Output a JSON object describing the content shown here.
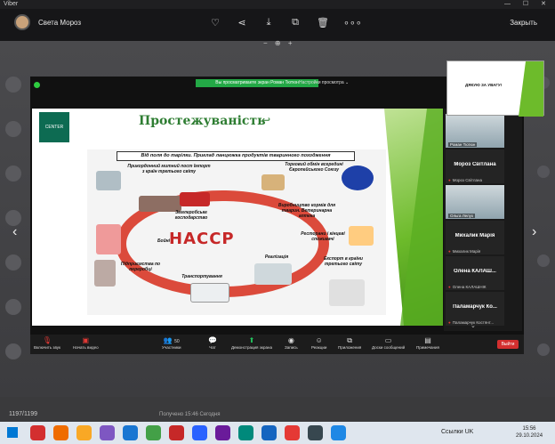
{
  "app": {
    "name": "Viber",
    "window_controls": "— ☐ ✕"
  },
  "viewer": {
    "sender": "Света Мороз",
    "close_label": "Закрыть",
    "icons": [
      "heart-icon",
      "share-icon",
      "download-icon",
      "crop-icon",
      "trash-icon",
      "more-icon"
    ],
    "zoom_controls": "− ⊕ +"
  },
  "zoom": {
    "banner": "Вы просматриваете экран Роман Тютюн",
    "view_options": "Настройки просмотра ⌄",
    "slide": {
      "logo_text": "CENTER",
      "title": "Простежуваність",
      "caption": "Від поля до тарілки. Приклад ланцюжка продуктів тваринного походження",
      "center_label": "HACCP",
      "labels": {
        "border": "Прикордонний митний пост Імпорт з країн третього світу",
        "trade": "Торговий обмін всередині Європейського Союзу",
        "farm": "Землеробське господарство",
        "feed": "Виробництво кормів для тварин. Ветеринарна аптека",
        "slaughter": "Бойні",
        "restaurants": "Ресторани і кінцеві споживачі",
        "processing": "Підприємства по переробці",
        "retail": "Реалізація",
        "transport": "Транспортування",
        "export": "Експорт в країни третього світу"
      }
    },
    "participants": [
      {
        "type": "video",
        "name": "Роман Тютюн"
      },
      {
        "type": "tile",
        "title": "Мороз Світлана",
        "sub": "Мороз Світлана"
      },
      {
        "type": "video",
        "name": "Ольга Лелух"
      },
      {
        "type": "tile",
        "title": "Михалик Марія",
        "sub": "Михалик Марія"
      },
      {
        "type": "tile",
        "title": "Олена КАЛАШ...",
        "sub": "Олена КАЛАШНІК"
      },
      {
        "type": "tile",
        "title": "Паламарчук Ко...",
        "sub": "Паламарчук Костянт..."
      }
    ],
    "toolbar": {
      "mute": "Включить звук",
      "video": "Начать видео",
      "participants": "Участники",
      "participants_count": "50",
      "chat": "Чат",
      "share": "Демонстрация экрана",
      "record": "Запись",
      "reactions": "Реакции",
      "apps": "Приложения",
      "whiteboard": "Доски сообщений",
      "notes": "Примечания",
      "leave": "Выйти"
    },
    "thumbnail_text": "ДЯКУЮ ЗА УВАГУ!"
  },
  "status": {
    "counter": "1197/1199",
    "received": "Получено 15:46 Сегодня"
  },
  "taskbar": {
    "tray_links": "Ссылки",
    "language": "UK",
    "time": "15:56",
    "date": "29.10.2024"
  },
  "colors": {
    "accent_green": "#23a846",
    "leave_red": "#d32f2f",
    "slide_green": "#2e7d32"
  }
}
